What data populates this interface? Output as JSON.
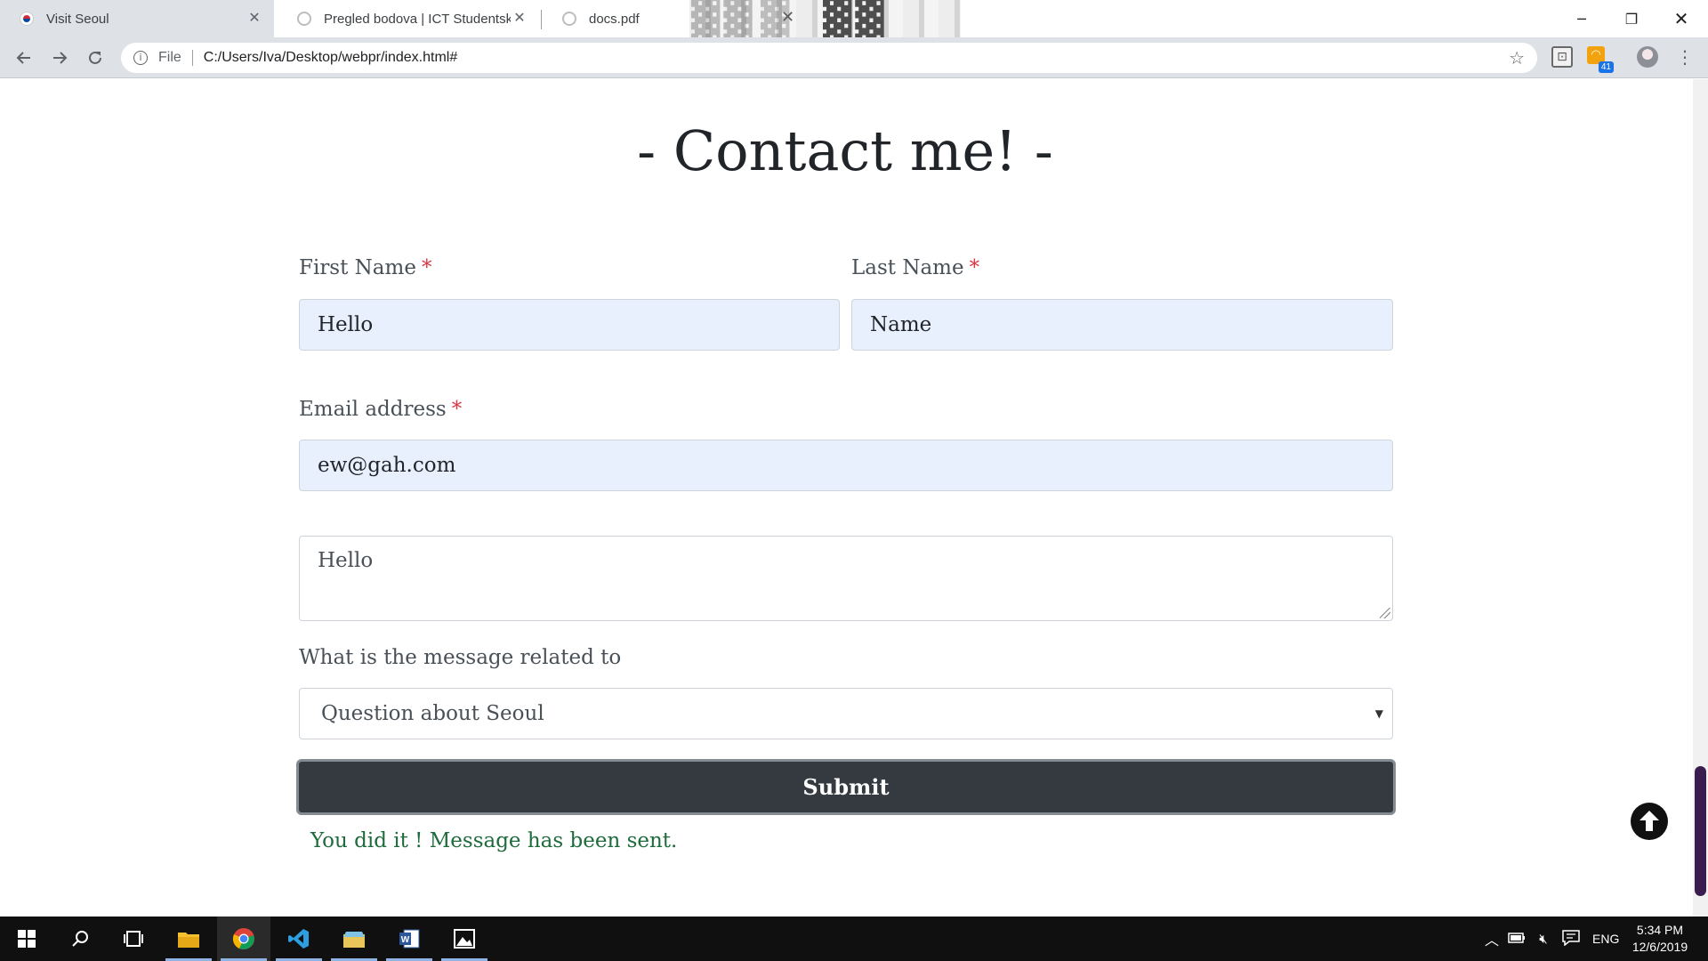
{
  "browser": {
    "tabs": [
      {
        "title": "Visit Seoul",
        "active": true
      },
      {
        "title": "Pregled bodova | ICT Studentski s",
        "active": false
      },
      {
        "title": "docs.pdf",
        "active": false
      }
    ],
    "address": {
      "scheme": "File",
      "url": "C:/Users/Iva/Desktop/webpr/index.html#"
    },
    "extension_badge": "41",
    "icons": {
      "back": "back-arrow-icon",
      "forward": "forward-arrow-icon",
      "reload": "reload-icon",
      "info": "info-icon",
      "star": "bookmark-star-icon",
      "menu": "menu-dots-icon"
    }
  },
  "page": {
    "title": "- Contact me! -",
    "form": {
      "first_name": {
        "label": "First Name",
        "required_mark": "*",
        "value": "Hello"
      },
      "last_name": {
        "label": "Last Name",
        "required_mark": "*",
        "value": "Name"
      },
      "email": {
        "label": "Email address",
        "required_mark": "*",
        "value": "ew@gah.com"
      },
      "message": {
        "value": "Hello"
      },
      "topic": {
        "label": "What is the message related to",
        "selected": "Question about Seoul"
      },
      "submit_label": "Submit"
    },
    "success_message": "You did it ! Message has been sent."
  },
  "taskbar": {
    "tray": {
      "language": "ENG"
    },
    "clock": {
      "time": "5:34 PM",
      "date": "12/6/2019"
    }
  },
  "colors": {
    "accent": "#343a40",
    "required": "#dc3545",
    "success": "#1e6b3c",
    "autofill": "#e8f0fe"
  }
}
